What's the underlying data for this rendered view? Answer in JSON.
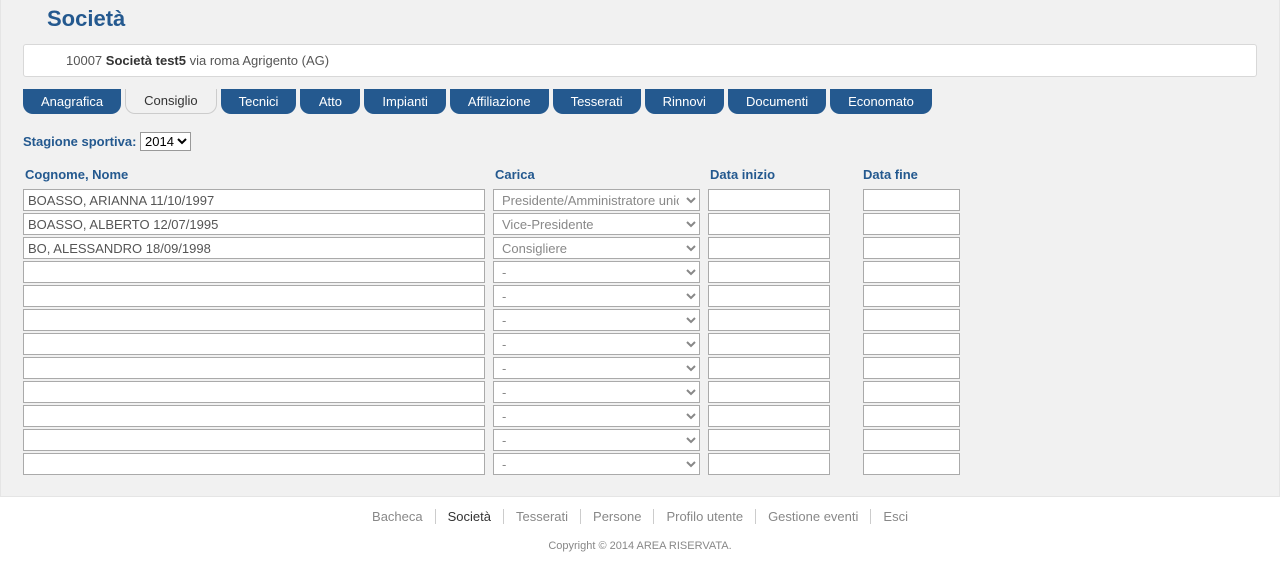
{
  "pageTitle": "Società",
  "summary": {
    "code": "10007",
    "name": "Società test5",
    "address": "via roma Agrigento (AG)"
  },
  "tabs": [
    {
      "label": "Anagrafica",
      "active": false
    },
    {
      "label": "Consiglio",
      "active": true
    },
    {
      "label": "Tecnici",
      "active": false
    },
    {
      "label": "Atto",
      "active": false
    },
    {
      "label": "Impianti",
      "active": false
    },
    {
      "label": "Affiliazione",
      "active": false
    },
    {
      "label": "Tesserati",
      "active": false
    },
    {
      "label": "Rinnovi",
      "active": false
    },
    {
      "label": "Documenti",
      "active": false
    },
    {
      "label": "Economato",
      "active": false
    }
  ],
  "seasonLabel": "Stagione sportiva:",
  "seasonValue": "2014",
  "columns": {
    "name": "Cognome, Nome",
    "role": "Carica",
    "start": "Data inizio",
    "end": "Data fine"
  },
  "roleOptions": [
    "-",
    "Presidente/Amministratore unico",
    "Vice-Presidente",
    "Consigliere"
  ],
  "rows": [
    {
      "name": "BOASSO, ARIANNA 11/10/1997",
      "role": "Presidente/Amministratore unico",
      "start": "",
      "end": ""
    },
    {
      "name": "BOASSO, ALBERTO 12/07/1995",
      "role": "Vice-Presidente",
      "start": "",
      "end": ""
    },
    {
      "name": "BO, ALESSANDRO 18/09/1998",
      "role": "Consigliere",
      "start": "",
      "end": ""
    },
    {
      "name": "",
      "role": "-",
      "start": "",
      "end": ""
    },
    {
      "name": "",
      "role": "-",
      "start": "",
      "end": ""
    },
    {
      "name": "",
      "role": "-",
      "start": "",
      "end": ""
    },
    {
      "name": "",
      "role": "-",
      "start": "",
      "end": ""
    },
    {
      "name": "",
      "role": "-",
      "start": "",
      "end": ""
    },
    {
      "name": "",
      "role": "-",
      "start": "",
      "end": ""
    },
    {
      "name": "",
      "role": "-",
      "start": "",
      "end": ""
    },
    {
      "name": "",
      "role": "-",
      "start": "",
      "end": ""
    },
    {
      "name": "",
      "role": "-",
      "start": "",
      "end": ""
    }
  ],
  "footerNav": [
    {
      "label": "Bacheca",
      "current": false
    },
    {
      "label": "Società",
      "current": true
    },
    {
      "label": "Tesserati",
      "current": false
    },
    {
      "label": "Persone",
      "current": false
    },
    {
      "label": "Profilo utente",
      "current": false
    },
    {
      "label": "Gestione eventi",
      "current": false
    },
    {
      "label": "Esci",
      "current": false
    }
  ],
  "copyright": "Copyright © 2014 AREA RISERVATA."
}
